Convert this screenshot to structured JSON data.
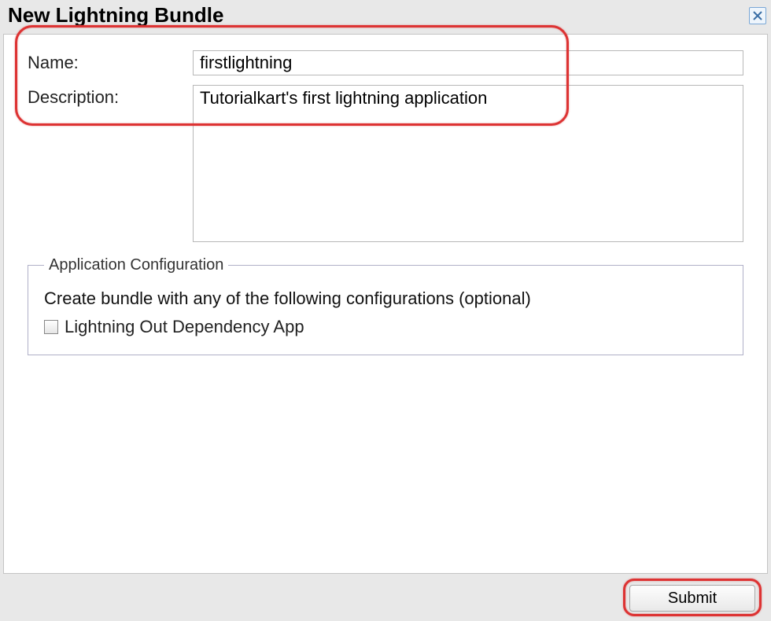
{
  "dialog": {
    "title": "New Lightning Bundle"
  },
  "form": {
    "name_label": "Name:",
    "name_value": "firstlightning",
    "description_label": "Description:",
    "description_value": "Tutorialkart's first lightning application"
  },
  "config": {
    "legend": "Application Configuration",
    "hint": "Create bundle with any of the following configurations (optional)",
    "option1_label": "Lightning Out Dependency App",
    "option1_checked": false
  },
  "footer": {
    "submit_label": "Submit"
  }
}
